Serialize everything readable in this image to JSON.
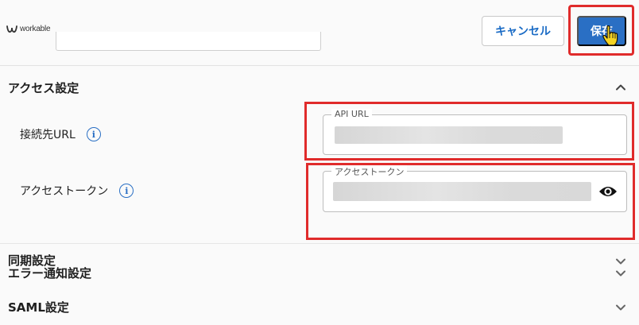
{
  "header": {
    "logo_text": "workable",
    "cancel_label": "キャンセル",
    "save_label": "保存"
  },
  "sections": {
    "access": {
      "title": "アクセス設定",
      "expanded": true
    },
    "sync": {
      "title": "同期設定",
      "expanded": false
    },
    "error_notify": {
      "title": "エラー通知設定",
      "expanded": false
    },
    "saml": {
      "title": "SAML設定",
      "expanded": false
    }
  },
  "fields": {
    "connection_url": {
      "label": "接続先URL",
      "input_label": "API URL",
      "value": ""
    },
    "access_token": {
      "label": "アクセストークン",
      "input_label": "アクセストークン",
      "value": ""
    }
  },
  "icons": {
    "info": "info-circle-icon",
    "visibility": "eye-icon",
    "expand": "chevron-down-icon",
    "collapse": "chevron-up-icon",
    "pointer": "hand-pointer-icon"
  },
  "colors": {
    "primary": "#2a6fc4",
    "highlight": "#e02b2b"
  }
}
